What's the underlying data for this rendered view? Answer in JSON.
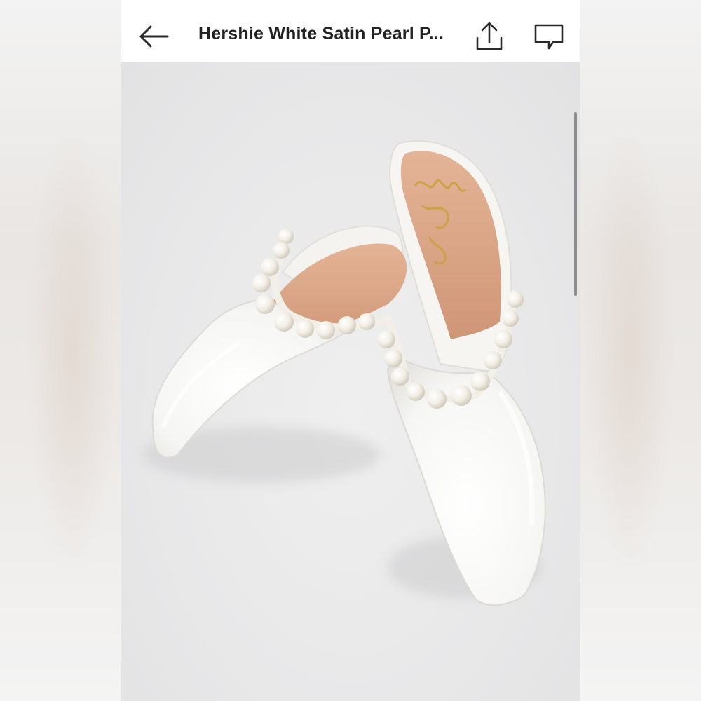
{
  "header": {
    "title": "Hershie White Satin Pearl P...",
    "back_icon": "arrow-left-icon",
    "share_icon": "share-upload-icon",
    "comment_icon": "comment-icon"
  },
  "product_image": {
    "subject": "white satin pointed-toe mules with pearl strap",
    "insole_brand_script": "lulus"
  },
  "colors": {
    "header_bg": "#ffffff",
    "title_text": "#222222",
    "image_bg": "#e9e9ea",
    "shoe_white": "#f7f7f5",
    "insole_tan": "#d9a384",
    "pearl": "#f4f1ea"
  }
}
